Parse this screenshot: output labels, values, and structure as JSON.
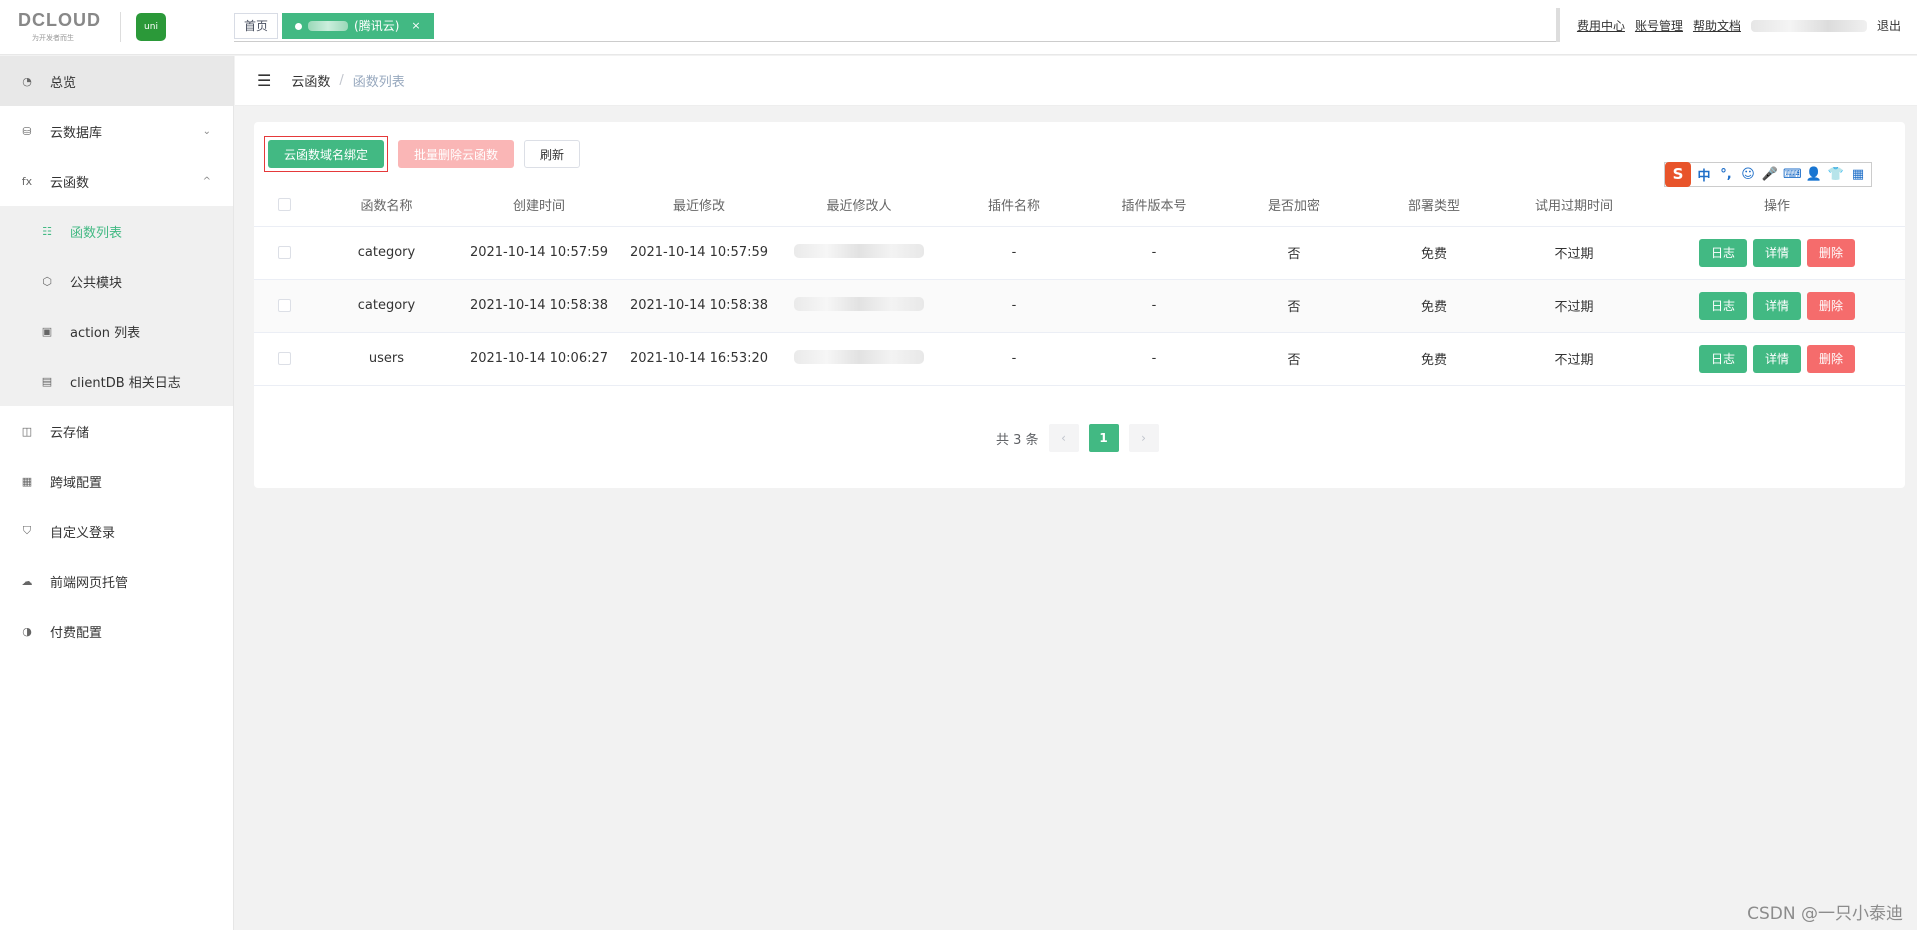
{
  "header": {
    "logo_text": "DCLOUD",
    "logo_subtitle": "为开发者而生",
    "uni_logo_text": "uni",
    "tabs": [
      {
        "label": "首页"
      },
      {
        "label": "(腾讯云)",
        "close": "×"
      }
    ],
    "nav": {
      "billing": "费用中心",
      "account": "账号管理",
      "help": "帮助文档",
      "logout": "退出"
    }
  },
  "sidebar": {
    "items": [
      {
        "label": "总览",
        "icon": "dashboard-icon"
      },
      {
        "label": "云数据库",
        "icon": "database-icon",
        "chevron": "⌄"
      },
      {
        "label": "云函数",
        "icon": "function-icon",
        "chevron": "^"
      },
      {
        "label": "函数列表",
        "icon": "list-icon"
      },
      {
        "label": "公共模块",
        "icon": "cube-icon"
      },
      {
        "label": "action 列表",
        "icon": "action-icon"
      },
      {
        "label": "clientDB 相关日志",
        "icon": "log-icon"
      },
      {
        "label": "云存储",
        "icon": "storage-icon"
      },
      {
        "label": "跨域配置",
        "icon": "cors-icon"
      },
      {
        "label": "自定义登录",
        "icon": "shield-icon"
      },
      {
        "label": "前端网页托管",
        "icon": "hosting-icon"
      },
      {
        "label": "付费配置",
        "icon": "pay-icon"
      }
    ]
  },
  "breadcrumb": {
    "level1": "云函数",
    "separator": "/",
    "level2": "函数列表"
  },
  "toolbar": {
    "bind_domain": "云函数域名绑定",
    "batch_delete": "批量删除云函数",
    "refresh": "刷新"
  },
  "table": {
    "headers": [
      "函数名称",
      "创建时间",
      "最近修改",
      "最近修改人",
      "插件名称",
      "插件版本号",
      "是否加密",
      "部署类型",
      "试用过期时间",
      "操作"
    ],
    "rows": [
      {
        "name": "category",
        "created": "2021-10-14 10:57:59",
        "modified": "2021-10-14 10:57:59",
        "plugin": "-",
        "plugin_version": "-",
        "encrypted": "否",
        "deploy": "免费",
        "expire": "不过期"
      },
      {
        "name": "category",
        "created": "2021-10-14 10:58:38",
        "modified": "2021-10-14 10:58:38",
        "plugin": "-",
        "plugin_version": "-",
        "encrypted": "否",
        "deploy": "免费",
        "expire": "不过期"
      },
      {
        "name": "users",
        "created": "2021-10-14 10:06:27",
        "modified": "2021-10-14 16:53:20",
        "plugin": "-",
        "plugin_version": "-",
        "encrypted": "否",
        "deploy": "免费",
        "expire": "不过期"
      }
    ],
    "actions": {
      "log": "日志",
      "detail": "详情",
      "delete": "删除"
    }
  },
  "pagination": {
    "total": "共 3 条",
    "prev": "‹",
    "current": "1",
    "next": "›"
  },
  "ime": {
    "logo": "S",
    "glyphs": [
      "中",
      "°,",
      "☺",
      "🎤",
      "⌨",
      "👤",
      "👕",
      "▦"
    ]
  },
  "watermark": "CSDN @一只小泰迪",
  "colors": {
    "accent": "#42b983",
    "danger": "#f56c6c",
    "danger_light": "#fab6b6"
  }
}
